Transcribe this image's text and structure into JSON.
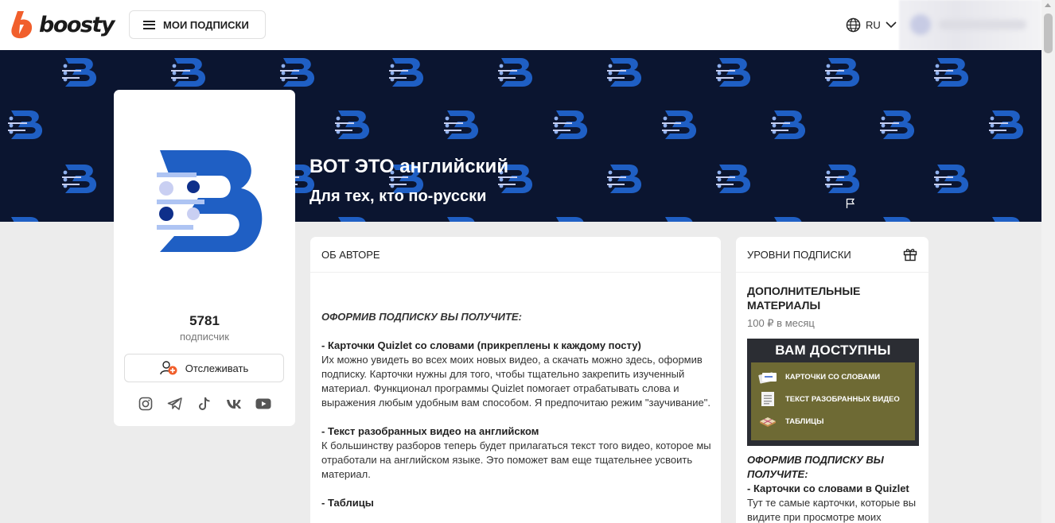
{
  "header": {
    "logo_text": "boosty",
    "subscriptions_label": "МОИ ПОДПИСКИ",
    "language": "RU"
  },
  "banner": {
    "title": "ВОТ ЭТО английский",
    "subtitle": "Для тех, кто по-русски"
  },
  "profile": {
    "subscribers_count": "5781",
    "subscribers_label": "подписчик",
    "follow_label": "Отслеживать",
    "socials": [
      "instagram-icon",
      "telegram-icon",
      "tiktok-icon",
      "vk-icon",
      "youtube-icon"
    ]
  },
  "about": {
    "heading": "ОБ АВТОРЕ",
    "intro": "ОФОРМИВ ПОДПИСКУ ВЫ ПОЛУЧИТЕ:",
    "item1_title": "- Карточки Quizlet со словами (прикреплены к каждому посту)",
    "item1_text": "Их можно увидеть во всех моих новых видео, а скачать можно здесь, оформив подписку. Карточки нужны для того, чтобы тщательно закрепить изученный материал. Функционал программы Quizlet помогает отрабатывать слова и выражения любым удобным вам способом. Я предпочитаю режим \"заучивание\".",
    "item2_title": "- Текст разобранных видео на английском",
    "item2_text": "К большинству разборов теперь будет прилагаться текст того видео, которое мы отработали на английском языке. Это поможет вам еще тщательнее усвоить материал.",
    "item3_title": "- Таблицы"
  },
  "levels": {
    "heading": "УРОВНИ ПОДПИСКИ",
    "tier_title": "ДОПОЛНИТЕЛЬНЫЕ МАТЕРИАЛЫ",
    "tier_price": "100 ₽ в месяц",
    "promo": {
      "title": "ВАМ ДОСТУПНЫ",
      "rows": [
        "КАРТОЧКИ СО СЛОВАМИ",
        "ТЕКСТ РАЗОБРАННЫХ ВИДЕО",
        "ТАБЛИЦЫ"
      ]
    },
    "desc_intro": "ОФОРМИВ ПОДПИСКУ ВЫ ПОЛУЧИТЕ:",
    "desc_item_title": "- Карточки со словами в Quizlet",
    "desc_item_text": "Тут те самые карточки, которые вы видите при просмотре моих"
  },
  "colors": {
    "brand_orange": "#f15f2c",
    "banner_bg": "#0b1530",
    "logo_blue": "#1f5fc4",
    "promo_olive": "#6e6a34"
  }
}
